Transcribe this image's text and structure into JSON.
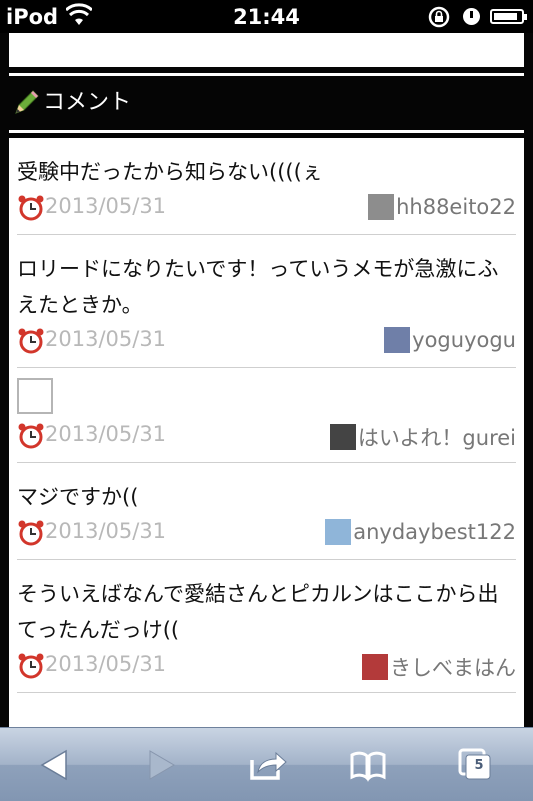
{
  "statusbar": {
    "carrier": "iPod",
    "time": "21:44",
    "battery_level": 0.9
  },
  "section": {
    "title": "コメント",
    "icon": "pencil-icon"
  },
  "comments": [
    {
      "text": "受験中だったから知らない((((ぇ",
      "date": "2013/05/31",
      "user": "hh88eito22",
      "has_image": false
    },
    {
      "text": "ロリードになりたいです！っていうメモが急激にふえたときか。",
      "date": "2013/05/31",
      "user": "yoguyogu",
      "has_image": false
    },
    {
      "text": "",
      "date": "2013/05/31",
      "user": "はいよれ！gurei",
      "has_image": true
    },
    {
      "text": "マジですか((",
      "date": "2013/05/31",
      "user": "anydaybest122",
      "has_image": false
    },
    {
      "text": "そういえばなんで愛結さんとピカルンはここから出てったんだっけ((",
      "date": "2013/05/31",
      "user": "きしべまはん",
      "has_image": false
    }
  ],
  "toolbar": {
    "tab_count": "5",
    "icons": [
      "back-arrow-icon",
      "forward-arrow-icon",
      "share-icon",
      "bookmarks-icon",
      "tabs-icon"
    ]
  },
  "colors": {
    "page_background": "#000000",
    "toolbar": "#a3b3c9",
    "date_text": "#b8b8b8",
    "user_text": "#777777"
  }
}
